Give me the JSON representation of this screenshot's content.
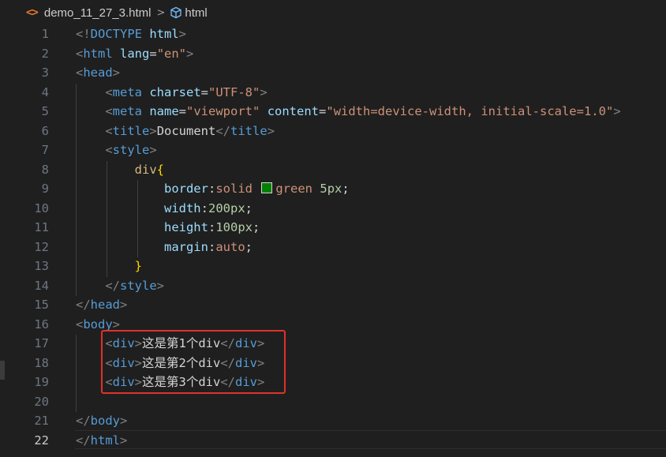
{
  "breadcrumb": {
    "file_icon": "<>",
    "file_name": "demo_11_27_3.html",
    "separator": ">",
    "symbol_icon": "cube-icon",
    "symbol_name": "html"
  },
  "editor": {
    "active_line": 22,
    "line_numbers": [
      "1",
      "2",
      "3",
      "4",
      "5",
      "6",
      "7",
      "8",
      "9",
      "10",
      "11",
      "12",
      "13",
      "14",
      "15",
      "16",
      "17",
      "18",
      "19",
      "20",
      "21",
      "22"
    ],
    "colors": {
      "background": "#1f1f1f",
      "tag": "#569cd6",
      "attribute": "#9cdcfe",
      "string": "#ce9178",
      "selector": "#d7ba7d",
      "brace": "#ffd700",
      "number": "#b5cea8",
      "swatch_green": "#008000",
      "highlight_box": "#e0312a"
    },
    "tokens": {
      "l1": [
        "<!",
        "DOCTYPE",
        "html",
        ">"
      ],
      "l2": [
        "<",
        "html",
        "lang",
        "=",
        "\"en\"",
        ">"
      ],
      "l3": [
        "<",
        "head",
        ">"
      ],
      "l4": [
        "<",
        "meta",
        "charset",
        "=",
        "\"UTF-8\"",
        ">"
      ],
      "l5": [
        "<",
        "meta",
        "name",
        "=",
        "\"viewport\"",
        "content",
        "=",
        "\"width=device-width, initial-scale=1.0\"",
        ">"
      ],
      "l6": [
        "<",
        "title",
        ">",
        "Document",
        "</",
        "title",
        ">"
      ],
      "l7": [
        "<",
        "style",
        ">"
      ],
      "l8": [
        "div",
        "{"
      ],
      "l9": [
        "border",
        ":",
        "solid",
        "green",
        "5px",
        ";"
      ],
      "l10": [
        "width",
        ":",
        "200px",
        ";"
      ],
      "l11": [
        "height",
        ":",
        "100px",
        ";"
      ],
      "l12": [
        "margin",
        ":",
        "auto",
        ";"
      ],
      "l13": [
        "}"
      ],
      "l14": [
        "</",
        "style",
        ">"
      ],
      "l15": [
        "</",
        "head",
        ">"
      ],
      "l16": [
        "<",
        "body",
        ">"
      ],
      "l17": [
        "<",
        "div",
        ">",
        "这是第1个div",
        "</",
        "div",
        ">"
      ],
      "l18": [
        "<",
        "div",
        ">",
        "这是第2个div",
        "</",
        "div",
        ">"
      ],
      "l19": [
        "<",
        "div",
        ">",
        "这是第3个div",
        "</",
        "div",
        ">"
      ],
      "l20": [],
      "l21": [
        "</",
        "body",
        ">"
      ],
      "l22": [
        "</",
        "html",
        ">"
      ]
    }
  }
}
